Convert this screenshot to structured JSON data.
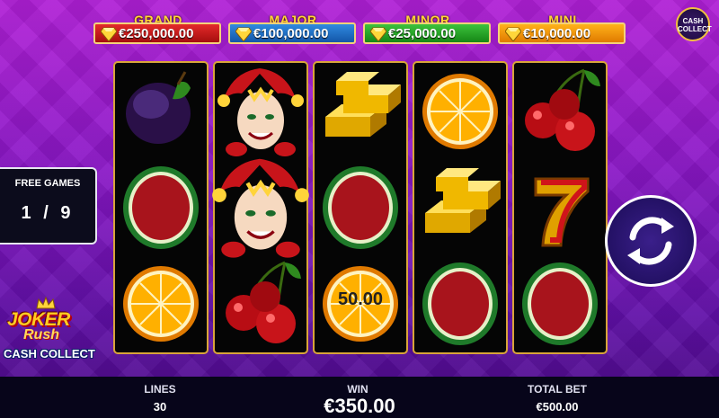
{
  "jackpots": {
    "grand": {
      "title": "GRAND",
      "value": "€250,000.00"
    },
    "major": {
      "title": "MAJOR",
      "value": "€100,000.00"
    },
    "minor": {
      "title": "MINOR",
      "value": "€25,000.00"
    },
    "mini": {
      "title": "MINI",
      "value": "€10,000.00"
    }
  },
  "cash_collect_badge": {
    "line1": "CASH",
    "line2": "COLLECT"
  },
  "free_games": {
    "title": "FREE GAMES",
    "count": "1 / 9"
  },
  "reels": [
    [
      "plum",
      "watermelon",
      "orange"
    ],
    [
      "joker",
      "joker-expanded",
      "cherry"
    ],
    [
      "gold-bars",
      "watermelon",
      "orange-cash"
    ],
    [
      "orange",
      "gold-bars",
      "watermelon"
    ],
    [
      "cherry",
      "seven",
      "watermelon"
    ]
  ],
  "cash_value": "50.00",
  "logo": {
    "line1": "JOKER",
    "line2": "Rush",
    "line3": "CASH COLLECT"
  },
  "bottom_bar": {
    "lines_label": "LINES",
    "lines_value": "30",
    "win_label": "WIN",
    "win_value": "€350.00",
    "total_bet_label": "TOTAL BET",
    "total_bet_value": "€500.00"
  },
  "colors": {
    "grand": "#c8141a",
    "major": "#1f6fd0",
    "minor": "#25a52a",
    "mini": "#f29a0c",
    "frame": "#d9a43a"
  }
}
